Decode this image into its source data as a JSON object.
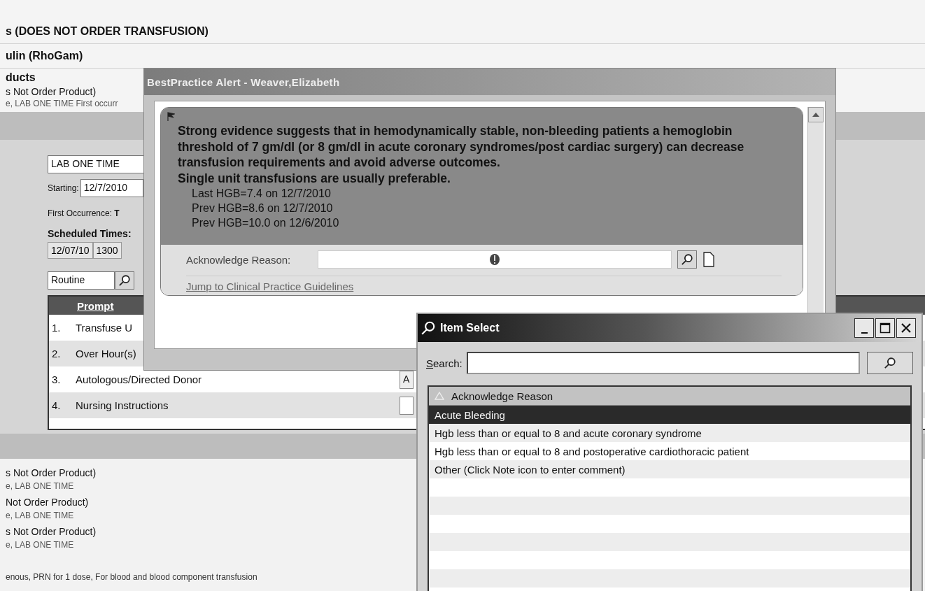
{
  "background": {
    "headings": [
      "s (DOES NOT ORDER TRANSFUSION)",
      "ulin (RhoGam)"
    ],
    "product_section": {
      "title": "ducts",
      "order": "s Not Order Product)",
      "detail": "e,  LAB ONE TIME First occurr"
    },
    "form": {
      "frequency": "LAB ONE TIME",
      "starting_label": "Starting:",
      "starting_value": "12/7/2010",
      "first_occurrence": "First Occurrence: **T**",
      "scheduled_label": "Scheduled Times:",
      "scheduled_date": "12/07/10",
      "scheduled_time": "1300",
      "priority": "Routine",
      "prompt_table": {
        "columns": [
          "Prompt"
        ],
        "rows": [
          {
            "number": "1.",
            "prompt": "Transfuse U",
            "kind": "text"
          },
          {
            "number": "2.",
            "prompt": "Over Hour(s)",
            "kind": "text"
          },
          {
            "number": "3.",
            "prompt": "Autologous/Directed Donor",
            "kind": "button",
            "answer": "A"
          },
          {
            "number": "4.",
            "prompt": "Nursing Instructions",
            "kind": "input"
          }
        ]
      }
    },
    "orders": [
      {
        "name": "s Not Order Product)",
        "detail": "e, LAB ONE TIME"
      },
      {
        "name": "Not Order Product)",
        "detail": "e, LAB ONE TIME"
      },
      {
        "name": "s Not Order Product)",
        "detail": "e, LAB ONE TIME"
      }
    ],
    "footer_note": "enous, PRN for 1 dose, For blood and blood component transfusion"
  },
  "alert_window": {
    "title": "BestPractice Alert  - Weaver,Elizabeth",
    "message": "Strong evidence suggests that in hemodynamically stable, non-bleeding patients a hemoglobin threshold of 7 gm/dl (or 8 gm/dl in acute coronary syndromes/post cardiac surgery) can decrease transfusion requirements and avoid adverse outcomes.",
    "recommendation": "Single unit transfusions are usually preferable.",
    "lab_results": [
      "Last HGB=7.4 on 12/7/2010",
      "Prev HGB=8.6 on 12/7/2010",
      "Prev HGB=10.0 on 12/6/2010"
    ],
    "acknowledge_label": "Acknowledge Reason:",
    "link": "Jump to Clinical Practice Guidelines"
  },
  "item_select": {
    "title": "Item Select",
    "search_label": "Search:",
    "column": "Acknowledge Reason",
    "items": [
      {
        "label": "Acute Bleeding",
        "selected": true
      },
      {
        "label": "Hgb less than or equal to 8 and acute coronary syndrome",
        "selected": false
      },
      {
        "label": "Hgb less than or equal to 8 and postoperative cardiothoracic patient",
        "selected": false
      },
      {
        "label": "Other (Click Note icon to enter comment)",
        "selected": false
      }
    ]
  }
}
